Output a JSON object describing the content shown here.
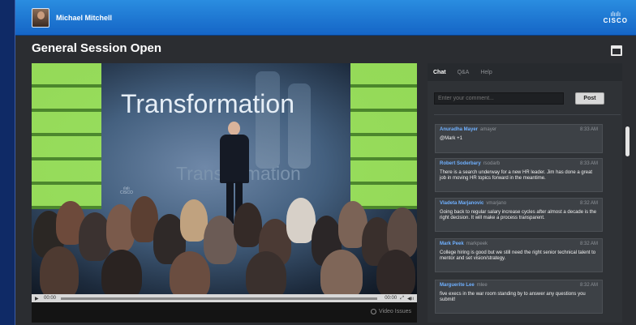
{
  "header": {
    "username": "Michael Mitchell",
    "logo_word": "CISCO"
  },
  "page": {
    "title": "General Session Open"
  },
  "video": {
    "screen_text": "Transformation",
    "screen_text_echo": "Transformation",
    "controls": {
      "current_time": "00:00",
      "end_time": "00:00"
    },
    "issues_label": "Video Issues"
  },
  "chat_panel": {
    "tabs": [
      {
        "label": "Chat",
        "active": true
      },
      {
        "label": "Q&A",
        "active": false
      },
      {
        "label": "Help",
        "active": false
      }
    ],
    "comment_placeholder": "Enter your comment...",
    "post_label": "Post",
    "messages": [
      {
        "name": "Anuradha Mayer",
        "handle": "amayer",
        "time": "8:33 AM",
        "text": "@Mark +1"
      },
      {
        "name": "Robert Soderbary",
        "handle": "rsodarb",
        "time": "8:33 AM",
        "text": "There is a search underway for a new HR leader. Jim has done a great job in moving HR topics forward in the meantime."
      },
      {
        "name": "Vladeta Marjanovic",
        "handle": "vmarjano",
        "time": "8:32 AM",
        "text": "Going back to regular salary increase cycles after almost a decade is the right decision. It will make a process transparent."
      },
      {
        "name": "Mark Peek",
        "handle": "markpeek",
        "time": "8:32 AM",
        "text": "College hiring is good but we still need the right senior technical talent to mentor and set vision/strategy."
      },
      {
        "name": "Marguerite Lee",
        "handle": "mlee",
        "time": "8:32 AM",
        "text": "five execs in the war room standing by to answer any questions you submit!"
      }
    ]
  },
  "colors": {
    "header_blue": "#1d73d4",
    "panel_dark": "#2f3236",
    "username_blue": "#6fb0ff",
    "screen_green": "#9be35a"
  },
  "icons": [
    "avatar",
    "cisco-logo",
    "popout-icon",
    "play-icon",
    "fullscreen-icon",
    "volume-icon",
    "info-icon"
  ]
}
